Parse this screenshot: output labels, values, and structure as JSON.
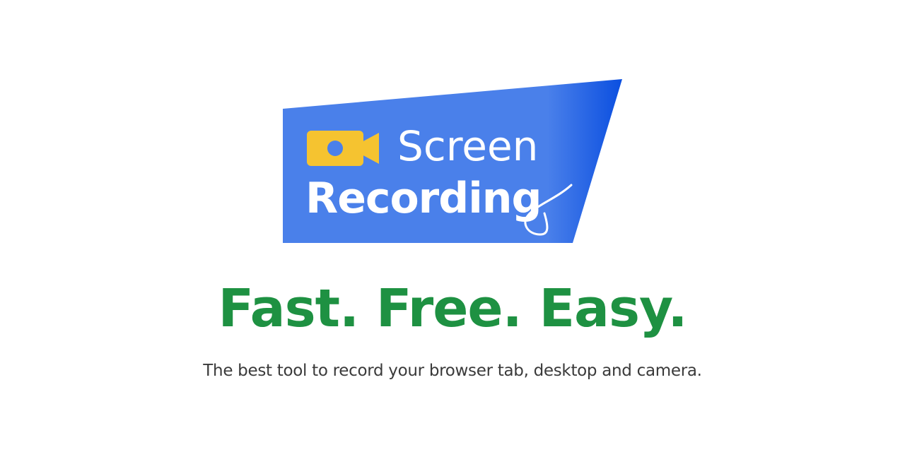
{
  "logo": {
    "line1": "Screen",
    "line2": "Recording",
    "camera_icon": "video-camera-icon",
    "colors": {
      "banner": "#4a80ea",
      "banner_edge": "#0b4fe0",
      "camera": "#f5c330",
      "camera_lens": "#4a80ea",
      "text": "#ffffff"
    }
  },
  "headline": {
    "text": "Fast. Free. Easy.",
    "color": "#1e9142"
  },
  "description": {
    "text": "The best tool to record your browser tab, desktop and camera.",
    "color": "#3a3a3a"
  }
}
